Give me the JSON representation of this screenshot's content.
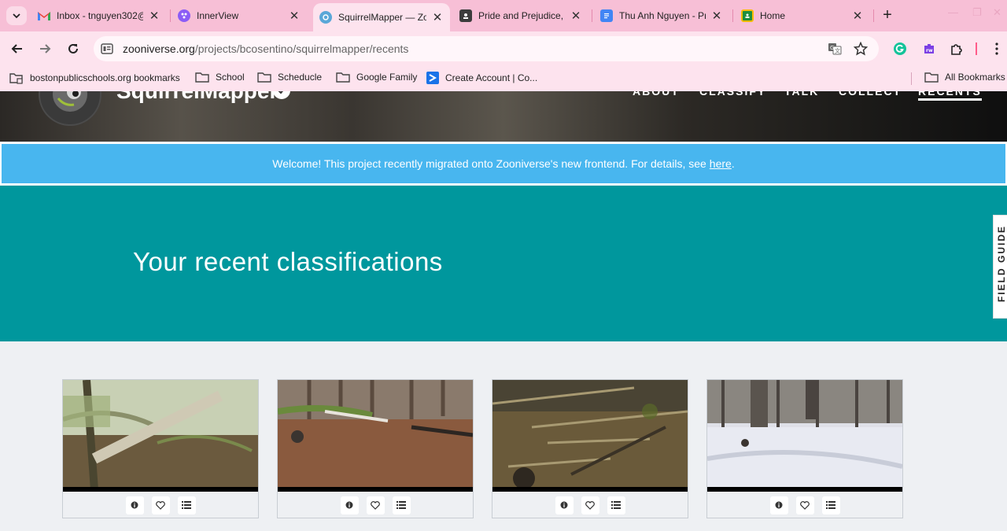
{
  "browser": {
    "tabs": [
      {
        "title": "Inbox - tnguyen302@",
        "icon": "gmail-icon",
        "active": false
      },
      {
        "title": "InnerView",
        "icon": "innerview-icon",
        "active": false
      },
      {
        "title": "SquirrelMapper — Zo",
        "icon": "zooniverse-icon",
        "active": true
      },
      {
        "title": "Pride and Prejudice,",
        "icon": "classroom-icon",
        "active": false
      },
      {
        "title": "Thu Anh Nguyen - Pr",
        "icon": "docs-icon",
        "active": false
      },
      {
        "title": "Home",
        "icon": "classroom-home-icon",
        "active": false
      }
    ],
    "url_domain": "zooniverse.org",
    "url_path": "/projects/bcosentino/squirrelmapper/recents",
    "bookmarks": [
      {
        "label": "bostonpublicschools.org bookmarks",
        "icon": "managed-bookmarks-icon"
      },
      {
        "label": "School",
        "icon": "folder-icon"
      },
      {
        "label": "Scheducle",
        "icon": "folder-icon"
      },
      {
        "label": "Google Family",
        "icon": "folder-icon"
      },
      {
        "label": "Create Account | Co...",
        "icon": "site-icon"
      }
    ],
    "all_bookmarks": "All Bookmarks"
  },
  "project": {
    "title": "SquirrelMapper",
    "nav": [
      "ABOUT",
      "CLASSIFY",
      "TALK",
      "COLLECT",
      "RECENTS"
    ],
    "active_nav": "RECENTS"
  },
  "banner": {
    "text": "Welcome! This project recently migrated onto Zooniverse's new frontend. For details, see",
    "link": "here",
    "end": "."
  },
  "hero": {
    "title": "Your recent classifications"
  },
  "field_guide": "FIELD GUIDE",
  "cards": [
    {
      "scene": "misty-forest"
    },
    {
      "scene": "leaf-litter"
    },
    {
      "scene": "forest-floor"
    },
    {
      "scene": "snowy-forest"
    }
  ],
  "colors": {
    "tabstrip": "#f7bfd6",
    "toolbar": "#fde3ee",
    "banner": "#48b6ef",
    "hero": "#00979d",
    "page": "#eef0f3"
  }
}
